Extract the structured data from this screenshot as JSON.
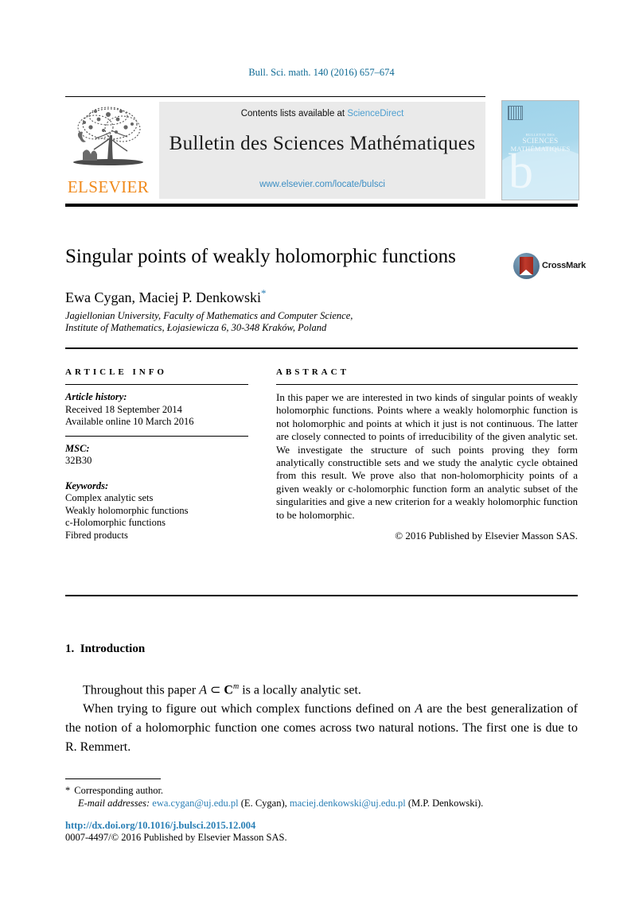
{
  "running_head": "Bull. Sci. math. 140 (2016) 657–674",
  "banner": {
    "contents_prefix": "Contents lists available at ",
    "sciencedirect": "ScienceDirect",
    "journal_title": "Bulletin des Sciences Mathématiques",
    "journal_url": "www.elsevier.com/locate/bulsci",
    "publisher_wordmark": "ELSEVIER",
    "cover": {
      "line1": "BULLETIN DES",
      "line2": "SCIENCES",
      "line3": "MATHÉMATIQUES",
      "watermark": "b"
    }
  },
  "article": {
    "title": "Singular points of weakly holomorphic functions",
    "authors": "Ewa Cygan, Maciej P. Denkowski",
    "corresponding_marker": "*",
    "affiliation_line1": "Jagiellonian University, Faculty of Mathematics and Computer Science,",
    "affiliation_line2": "Institute of Mathematics, Łojasiewicza 6, 30-348 Kraków, Poland",
    "crossmark_label": "CrossMark"
  },
  "info": {
    "heading": "ARTICLE INFO",
    "history_label": "Article history:",
    "received": "Received 18 September 2014",
    "available": "Available online 10 March 2016",
    "msc_label": "MSC:",
    "msc_value": "32B30",
    "keywords_label": "Keywords:",
    "keywords": [
      "Complex analytic sets",
      "Weakly holomorphic functions",
      "c-Holomorphic functions",
      "Fibred products"
    ]
  },
  "abstract": {
    "heading": "ABSTRACT",
    "text": "In this paper we are interested in two kinds of singular points of weakly holomorphic functions. Points where a weakly holomorphic function is not holomorphic and points at which it just is not continuous. The latter are closely connected to points of irreducibility of the given analytic set. We investigate the structure of such points proving they form analytically constructible sets and we study the analytic cycle obtained from this result. We prove also that non-holomorphicity points of a given weakly or c-holomorphic function form an analytic subset of the singularities and give a new criterion for a weakly holomorphic function to be holomorphic.",
    "copyright": "© 2016 Published by Elsevier Masson SAS."
  },
  "body": {
    "section_number": "1.",
    "section_title": "Introduction",
    "paragraph1_pre": "Throughout this paper ",
    "paragraph1_math_a": "A",
    "paragraph1_math_sub": " ⊂ ",
    "paragraph1_math_c": "C",
    "paragraph1_math_exp": "m",
    "paragraph1_post": " is a locally analytic set.",
    "paragraph2_pre": "When trying to figure out which complex functions defined on ",
    "paragraph2_math": "A",
    "paragraph2_post": " are the best generalization of the notion of a holomorphic function one comes across two natural notions. The first one is due to R. Remmert."
  },
  "footnotes": {
    "star": "*",
    "corresponding": "Corresponding author.",
    "email_label": "E-mail addresses:",
    "email1": "ewa.cygan@uj.edu.pl",
    "email1_owner": "(E. Cygan),",
    "email2": "maciej.denkowski@uj.edu.pl",
    "email2_owner": "(M.P. Denkowski)."
  },
  "footer": {
    "doi": "http://dx.doi.org/10.1016/j.bulsci.2015.12.004",
    "issn_copyright": "0007-4497/© 2016 Published by Elsevier Masson SAS."
  },
  "colors": {
    "link_blue": "#2a7fb5",
    "sciencedirect_blue": "#4d9fd0",
    "running_head_blue": "#0f6a94",
    "elsevier_orange": "#f08a1c",
    "cover_blue": "#a9d8ec",
    "crossmark_red": "#c0392b"
  }
}
